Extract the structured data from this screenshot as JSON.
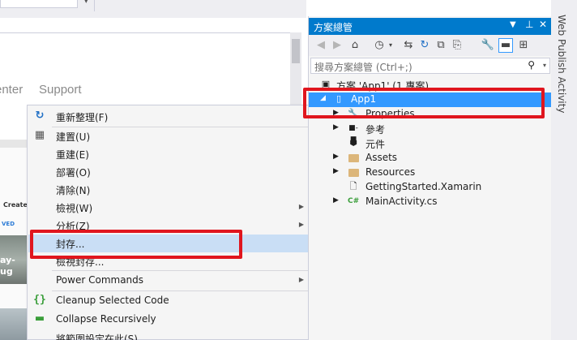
{
  "editor": {
    "nav_center": "enter",
    "nav_support": "Support",
    "preview_header": "Create",
    "preview_tab": "VED",
    "preview_overlay": "ay-\nug"
  },
  "context_menu": {
    "items": [
      {
        "label": "重新整理(F)",
        "icon": "refresh-icon"
      },
      {
        "label": "建置(U)",
        "icon": "build-icon"
      },
      {
        "label": "重建(E)",
        "icon": ""
      },
      {
        "label": "部署(O)",
        "icon": ""
      },
      {
        "label": "清除(N)",
        "icon": ""
      },
      {
        "label": "檢視(W)",
        "icon": "",
        "submenu": true
      },
      {
        "label": "分析(Z)",
        "icon": "",
        "submenu": true
      },
      {
        "label": "封存...",
        "icon": "",
        "highlighted": true
      },
      {
        "label": "檢視封存...",
        "icon": ""
      },
      {
        "label": "Power Commands",
        "icon": "",
        "submenu": true
      },
      {
        "label": "Cleanup Selected Code",
        "icon": "braces-icon"
      },
      {
        "label": "Collapse Recursively",
        "icon": "collapse-icon"
      },
      {
        "label": "將範圍設定在此(S)",
        "icon": ""
      }
    ]
  },
  "solution_explorer": {
    "title": "方案總管",
    "search_placeholder": "搜尋方案總管 (Ctrl+;)",
    "tree": [
      {
        "label": "方案 'App1' (1 專案)",
        "icon": "solution-icon",
        "level": 0
      },
      {
        "label": "App1",
        "icon": "project-icon",
        "level": 1,
        "selected": true
      },
      {
        "label": "Properties",
        "icon": "wrench-icon",
        "level": 2
      },
      {
        "label": "參考",
        "icon": "references-icon",
        "level": 2
      },
      {
        "label": "元件",
        "icon": "component-icon",
        "level": 2
      },
      {
        "label": "Assets",
        "icon": "folder-icon",
        "level": 2
      },
      {
        "label": "Resources",
        "icon": "folder-icon",
        "level": 2
      },
      {
        "label": "GettingStarted.Xamarin",
        "icon": "file-icon",
        "level": 2
      },
      {
        "label": "MainActivity.cs",
        "icon": "csharp-icon",
        "level": 2
      }
    ]
  },
  "side_tab": {
    "label": "Web Publish Activity"
  },
  "colors": {
    "accent": "#007acc",
    "selection": "#3399ff",
    "menu_highlight": "#c9def5",
    "annotation": "#e0161e"
  }
}
